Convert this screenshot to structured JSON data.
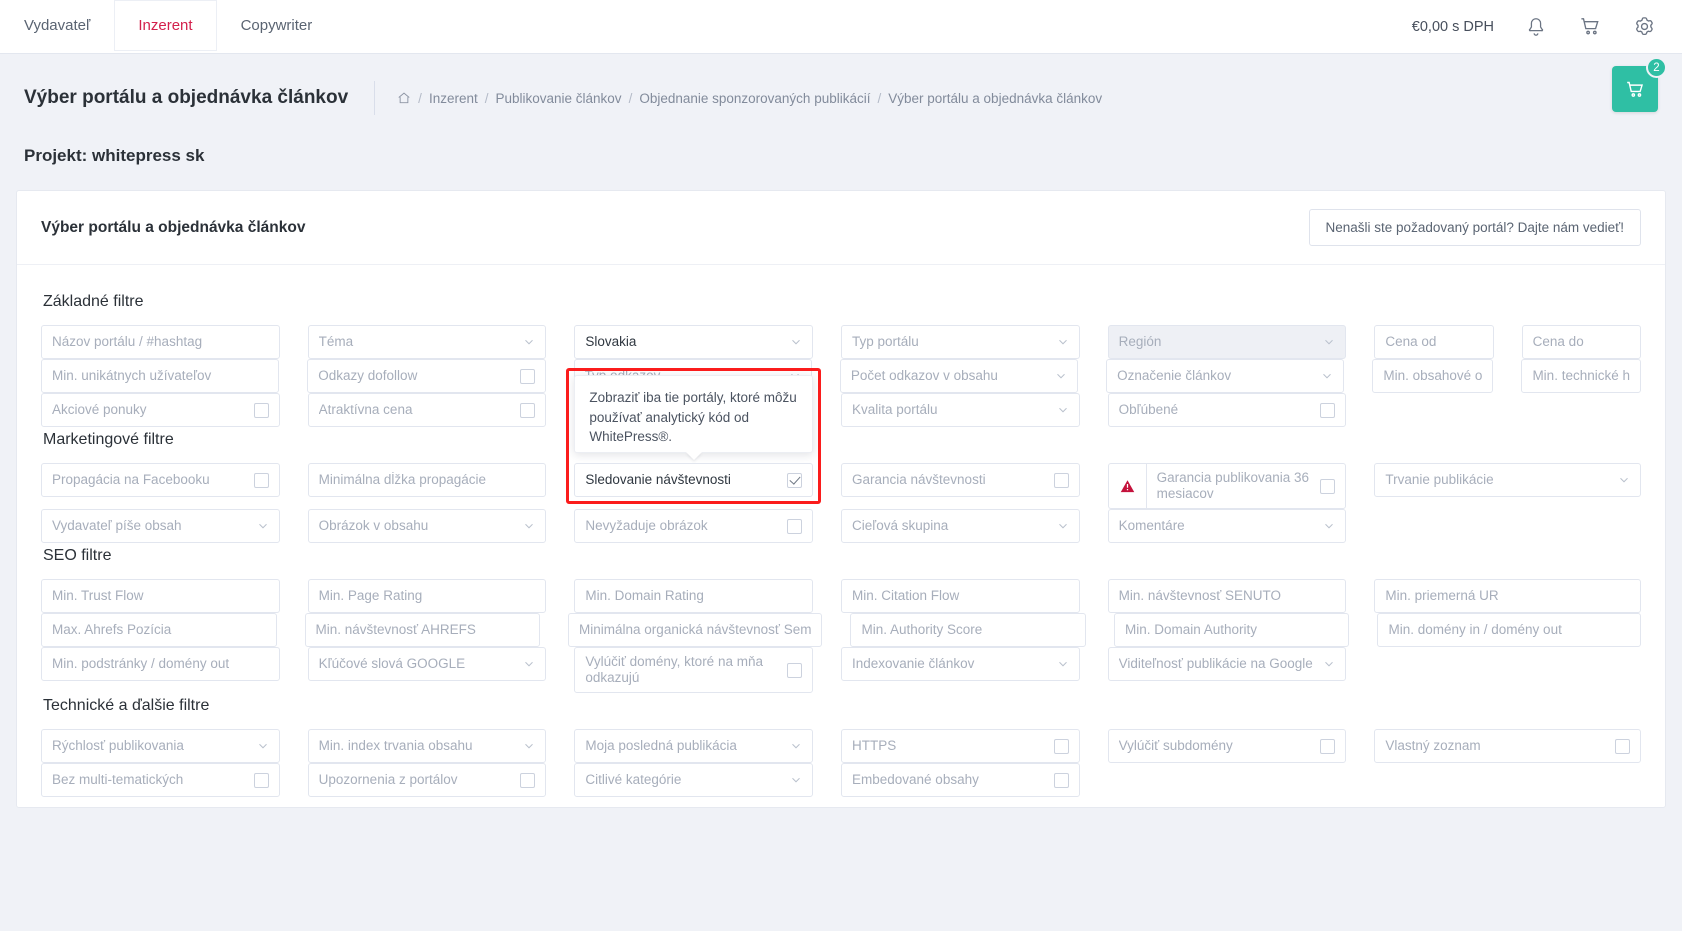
{
  "topnav": {
    "tabs": [
      {
        "label": "Vydavateľ",
        "active": false
      },
      {
        "label": "Inzerent",
        "active": true
      },
      {
        "label": "Copywriter",
        "active": false
      }
    ],
    "balance": "€0,00 s DPH",
    "icons": [
      "bell-icon",
      "cart-icon",
      "gear-icon"
    ]
  },
  "header": {
    "title": "Výber portálu a objednávka článkov",
    "breadcrumb": [
      "Inzerent",
      "Publikovanie článkov",
      "Objednanie sponzorovaných publikácií",
      "Výber portálu a objednávka článkov"
    ],
    "project": "Projekt: whitepress sk",
    "cart_badge": "2"
  },
  "card": {
    "title": "Výber portálu a objednávka článkov",
    "request_button": "Nenašli ste požadovaný portál? Dajte nám vedieť!"
  },
  "tooltip": {
    "text": "Zobraziť iba tie portály, ktoré môžu používať analytický kód od WhitePress®."
  },
  "sections": [
    {
      "title": "Základné filtre",
      "rows": [
        [
          {
            "label": "Názov portálu / #hashtag",
            "type": "text"
          },
          {
            "label": "Téma",
            "type": "select"
          },
          {
            "label": "Slovakia",
            "type": "select",
            "filled": true
          },
          {
            "label": "Typ portálu",
            "type": "select"
          },
          {
            "label": "Región",
            "type": "select",
            "disabled": true
          },
          {
            "label": "Cena od",
            "type": "text"
          },
          {
            "label": "Cena do",
            "type": "text"
          }
        ],
        [
          {
            "label": "Min. unikátnych užívateľov",
            "type": "text"
          },
          {
            "label": "Odkazy dofollow",
            "type": "checkbox"
          },
          {
            "label": "Typ odkazov",
            "type": "select"
          },
          {
            "label": "Počet odkazov v obsahu",
            "type": "select"
          },
          {
            "label": "Označenie článkov",
            "type": "select"
          },
          {
            "label": "Min. obsahové o",
            "type": "text"
          },
          {
            "label": "Min. technické h",
            "type": "text"
          }
        ],
        [
          {
            "label": "Akciové ponuky",
            "type": "checkbox"
          },
          {
            "label": "Atraktívna cena",
            "type": "checkbox"
          },
          {
            "label": "",
            "type": "spacer"
          },
          {
            "label": "Kvalita portálu",
            "type": "select"
          },
          {
            "label": "Obľúbené",
            "type": "checkbox"
          },
          {
            "label": "",
            "type": "spacer"
          },
          {
            "label": "",
            "type": "spacer"
          }
        ]
      ]
    },
    {
      "title": "Marketingové filtre",
      "rows": [
        [
          {
            "label": "Propagácia na Facebooku",
            "type": "checkbox"
          },
          {
            "label": "Minimálna dĺžka propagácie",
            "type": "text"
          },
          {
            "label": "Sledovanie návštevnosti",
            "type": "checkbox",
            "filled": true,
            "checked": true
          },
          {
            "label": "Garancia návštevnosti",
            "type": "checkbox"
          },
          {
            "label": "Garancia publikovania 36 mesiacov",
            "type": "checkbox",
            "icon": "warning-icon",
            "tall": true
          },
          {
            "label": "Trvanie publikácie",
            "type": "select",
            "span": 2
          }
        ],
        [
          {
            "label": "Vydavateľ píše obsah",
            "type": "select"
          },
          {
            "label": "Obrázok v obsahu",
            "type": "select"
          },
          {
            "label": "Nevyžaduje obrázok",
            "type": "checkbox"
          },
          {
            "label": "Cieľová skupina",
            "type": "select"
          },
          {
            "label": "Komentáre",
            "type": "select"
          },
          {
            "label": "",
            "type": "spacer"
          },
          {
            "label": "",
            "type": "spacer"
          }
        ]
      ]
    },
    {
      "title": "SEO filtre",
      "rows": [
        [
          {
            "label": "Min. Trust Flow",
            "type": "text"
          },
          {
            "label": "Min. Page Rating",
            "type": "text"
          },
          {
            "label": "Min. Domain Rating",
            "type": "text"
          },
          {
            "label": "Min. Citation Flow",
            "type": "text"
          },
          {
            "label": "Min. návštevnosť SENUTO",
            "type": "text"
          },
          {
            "label": "Min. priemerná UR",
            "type": "text",
            "span": 2
          }
        ],
        [
          {
            "label": "Max. Ahrefs Pozícia",
            "type": "text"
          },
          {
            "label": "Min. návštevnosť AHREFS",
            "type": "text"
          },
          {
            "label": "Minimálna organická návštevnosť Sem",
            "type": "text"
          },
          {
            "label": "Min. Authority Score",
            "type": "text"
          },
          {
            "label": "Min. Domain Authority",
            "type": "text"
          },
          {
            "label": "Min. domény in / domény out",
            "type": "text",
            "span": 2
          }
        ],
        [
          {
            "label": "Min. podstránky / domény out",
            "type": "text"
          },
          {
            "label": "Kľúčové slová GOOGLE",
            "type": "select"
          },
          {
            "label": "Vylúčiť domény, ktoré na mňa odkazujú",
            "type": "checkbox",
            "tall": true
          },
          {
            "label": "Indexovanie článkov",
            "type": "select"
          },
          {
            "label": "Viditeľnosť publikácie na Google",
            "type": "select"
          },
          {
            "label": "",
            "type": "spacer"
          },
          {
            "label": "",
            "type": "spacer"
          }
        ]
      ]
    },
    {
      "title": "Technické a ďalšie filtre",
      "rows": [
        [
          {
            "label": "Rýchlosť publikovania",
            "type": "select"
          },
          {
            "label": "Min. index trvania obsahu",
            "type": "select"
          },
          {
            "label": "Moja posledná publikácia",
            "type": "select"
          },
          {
            "label": "HTTPS",
            "type": "checkbox"
          },
          {
            "label": "Vylúčiť subdomény",
            "type": "checkbox"
          },
          {
            "label": "Vlastný zoznam",
            "type": "checkbox",
            "span": 2
          }
        ],
        [
          {
            "label": "Bez multi-tematických",
            "type": "checkbox"
          },
          {
            "label": "Upozornenia z portálov",
            "type": "checkbox"
          },
          {
            "label": "Citlivé kategórie",
            "type": "select"
          },
          {
            "label": "Embedované obsahy",
            "type": "checkbox"
          },
          {
            "label": "",
            "type": "spacer"
          },
          {
            "label": "",
            "type": "spacer"
          },
          {
            "label": "",
            "type": "spacer"
          }
        ]
      ]
    }
  ],
  "colors": {
    "accent": "#d3204c",
    "cart": "#2fbfa4",
    "highlight": "#fb1c1c"
  }
}
